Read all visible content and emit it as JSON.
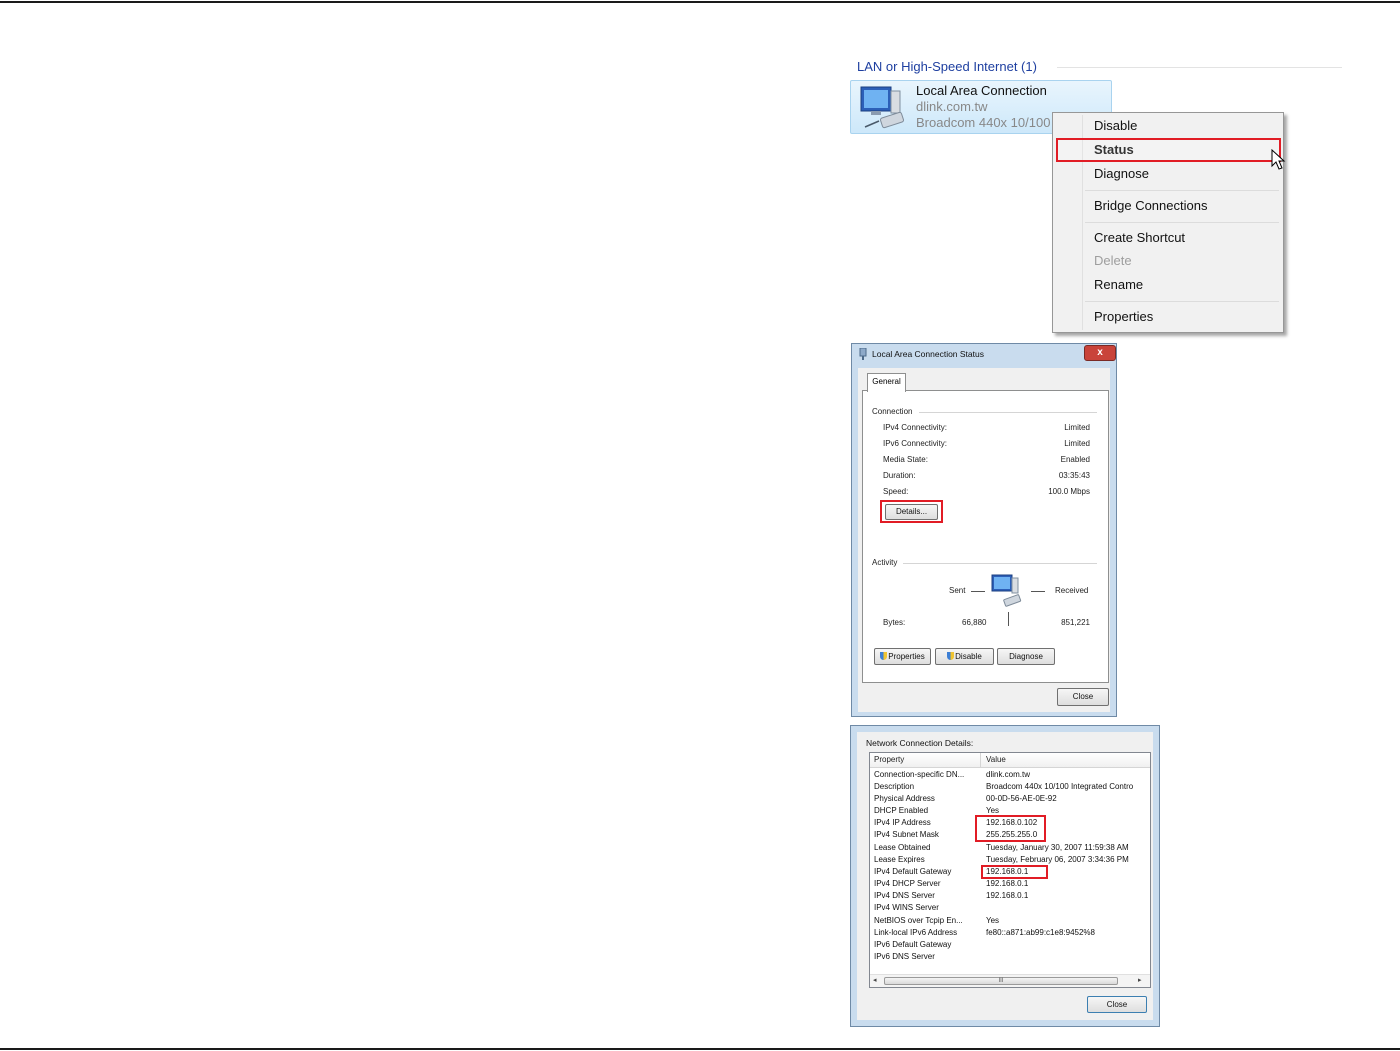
{
  "connections_panel": {
    "group_header": "LAN or High-Speed Internet (1)",
    "connection": {
      "name": "Local Area Connection",
      "domain": "dlink.com.tw",
      "adapter": "Broadcom 440x 10/100"
    },
    "context_menu": {
      "items": [
        "Disable",
        "Status",
        "Diagnose",
        "Bridge Connections",
        "Create Shortcut",
        "Delete",
        "Rename",
        "Properties"
      ],
      "highlighted": "Status",
      "disabled": [
        "Delete"
      ]
    }
  },
  "status_dialog": {
    "title": "Local Area Connection Status",
    "tab": "General",
    "connection_group": "Connection",
    "rows": [
      {
        "label": "IPv4 Connectivity:",
        "value": "Limited"
      },
      {
        "label": "IPv6 Connectivity:",
        "value": "Limited"
      },
      {
        "label": "Media State:",
        "value": "Enabled"
      },
      {
        "label": "Duration:",
        "value": "03:35:43"
      },
      {
        "label": "Speed:",
        "value": "100.0 Mbps"
      }
    ],
    "details_button": "Details...",
    "activity_group": "Activity",
    "sent_label": "Sent",
    "received_label": "Received",
    "bytes_label": "Bytes:",
    "bytes_sent": "66,880",
    "bytes_received": "851,221",
    "buttons": {
      "properties": "Properties",
      "disable": "Disable",
      "diagnose": "Diagnose",
      "close": "Close"
    },
    "close_glyph": "x"
  },
  "details_dialog": {
    "caption": "Network Connection Details:",
    "columns": [
      "Property",
      "Value"
    ],
    "rows": [
      {
        "property": "Connection-specific DN...",
        "value": "dlink.com.tw"
      },
      {
        "property": "Description",
        "value": "Broadcom 440x 10/100 Integrated Contro"
      },
      {
        "property": "Physical Address",
        "value": "00-0D-56-AE-0E-92"
      },
      {
        "property": "DHCP Enabled",
        "value": "Yes"
      },
      {
        "property": "IPv4 IP Address",
        "value": "192.168.0.102"
      },
      {
        "property": "IPv4 Subnet Mask",
        "value": "255.255.255.0"
      },
      {
        "property": "Lease Obtained",
        "value": "Tuesday, January 30, 2007 11:59:38 AM"
      },
      {
        "property": "Lease Expires",
        "value": "Tuesday, February 06, 2007 3:34:36 PM"
      },
      {
        "property": "IPv4 Default Gateway",
        "value": "192.168.0.1"
      },
      {
        "property": "IPv4 DHCP Server",
        "value": "192.168.0.1"
      },
      {
        "property": "IPv4 DNS Server",
        "value": "192.168.0.1"
      },
      {
        "property": "IPv4 WINS Server",
        "value": ""
      },
      {
        "property": "NetBIOS over Tcpip En...",
        "value": "Yes"
      },
      {
        "property": "Link-local IPv6 Address",
        "value": "fe80::a871:ab99:c1e8:9452%8"
      },
      {
        "property": "IPv6 Default Gateway",
        "value": ""
      },
      {
        "property": "IPv6 DNS Server",
        "value": ""
      }
    ],
    "scroll_grip": "III",
    "close_button": "Close"
  },
  "colors": {
    "highlight_red": "#e11c25",
    "group_header_blue": "#1e3fa0"
  },
  "icons": [
    "network-adapter-icon",
    "mouse-cursor-icon",
    "network-status-icon",
    "shield-icon"
  ]
}
